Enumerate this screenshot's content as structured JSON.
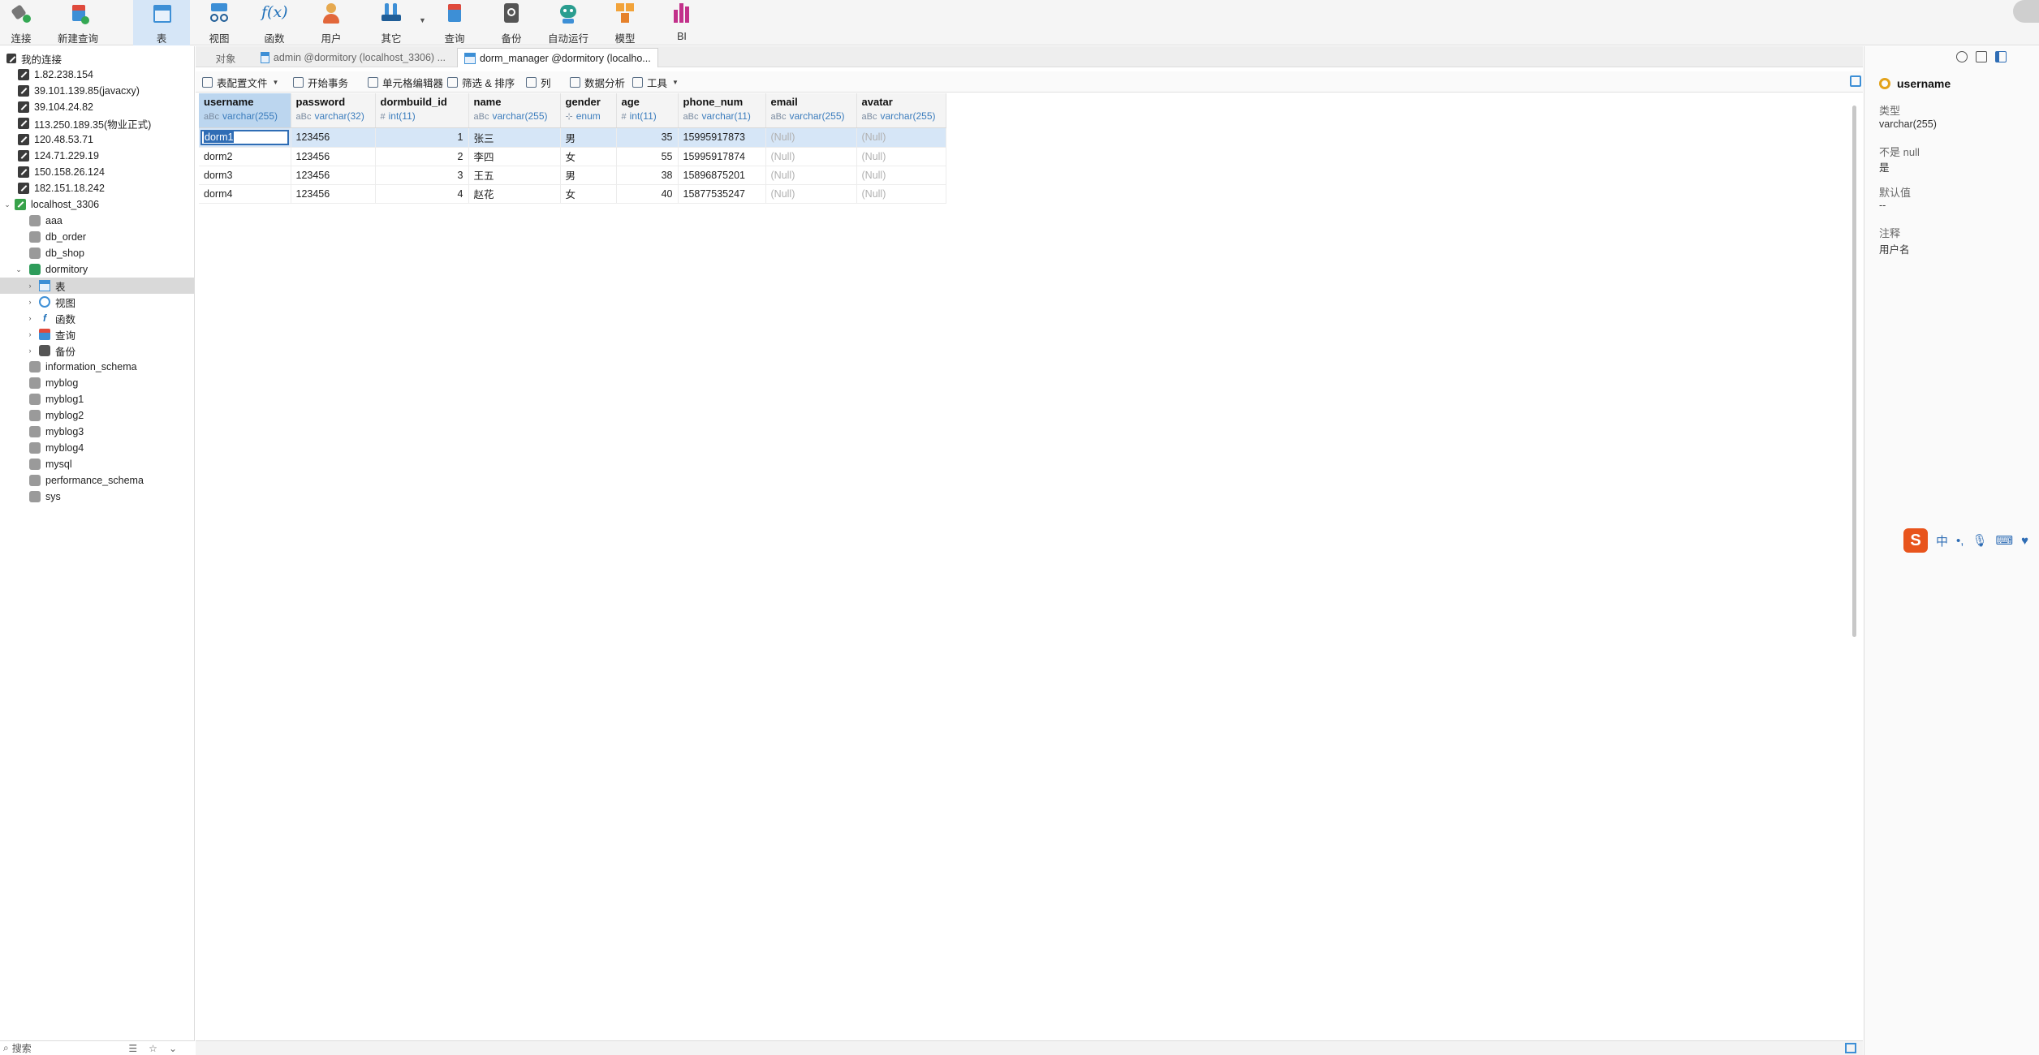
{
  "toolbar": {
    "connect": "连接",
    "new_query": "新建查询",
    "table": "表",
    "view": "视图",
    "function": "函数",
    "user": "用户",
    "other": "其它",
    "query": "查询",
    "backup": "备份",
    "automation": "自动运行",
    "model": "模型",
    "bi": "BI",
    "function_glyph": "f(x)"
  },
  "sidebar": {
    "header": "我的连接",
    "connections": [
      "1.82.238.154",
      "39.101.139.85(javacxy)",
      "39.104.24.82",
      "113.250.189.35(物业正式)",
      "120.48.53.71",
      "124.71.229.19",
      "150.158.26.124",
      "182.151.18.242"
    ],
    "localhost": "localhost_3306",
    "databases_before": [
      "aaa",
      "db_order",
      "db_shop"
    ],
    "open_db": "dormitory",
    "open_db_children": [
      "表",
      "视图",
      "函数",
      "查询",
      "备份"
    ],
    "databases_after": [
      "information_schema",
      "myblog",
      "myblog1",
      "myblog2",
      "myblog3",
      "myblog4",
      "mysql",
      "performance_schema",
      "sys"
    ],
    "search": "搜索"
  },
  "tabs": {
    "objects": "对象",
    "tab1": "admin @dormitory (localhost_3306) ...",
    "tab2": "dorm_manager @dormitory (localho..."
  },
  "subbar": {
    "config": "表配置文件",
    "begin_tx": "开始事务",
    "cell_editor": "单元格编辑器",
    "filter_sort": "筛选 & 排序",
    "columns": "列",
    "analysis": "数据分析",
    "tools": "工具"
  },
  "grid": {
    "columns": [
      {
        "name": "username",
        "type": "varchar(255)",
        "kind": "aBc"
      },
      {
        "name": "password",
        "type": "varchar(32)",
        "kind": "aBc"
      },
      {
        "name": "dormbuild_id",
        "type": "int(11)",
        "kind": "#"
      },
      {
        "name": "name",
        "type": "varchar(255)",
        "kind": "aBc"
      },
      {
        "name": "gender",
        "type": "enum",
        "kind": "⊹"
      },
      {
        "name": "age",
        "type": "int(11)",
        "kind": "#"
      },
      {
        "name": "phone_num",
        "type": "varchar(11)",
        "kind": "aBc"
      },
      {
        "name": "email",
        "type": "varchar(255)",
        "kind": "aBc"
      },
      {
        "name": "avatar",
        "type": "varchar(255)",
        "kind": "aBc"
      }
    ],
    "rows": [
      [
        "dorm1",
        "123456",
        "1",
        "张三",
        "男",
        "35",
        "15995917873",
        "(Null)",
        "(Null)"
      ],
      [
        "dorm2",
        "123456",
        "2",
        "李四",
        "女",
        "55",
        "15995917874",
        "(Null)",
        "(Null)"
      ],
      [
        "dorm3",
        "123456",
        "3",
        "王五",
        "男",
        "38",
        "15896875201",
        "(Null)",
        "(Null)"
      ],
      [
        "dorm4",
        "123456",
        "4",
        "赵花",
        "女",
        "40",
        "15877535247",
        "(Null)",
        "(Null)"
      ]
    ]
  },
  "rpanel": {
    "field": "username",
    "type_label": "类型",
    "type_value": "varchar(255)",
    "notnull_label": "不是 null",
    "notnull_value": "是",
    "default_label": "默认值",
    "default_value": "--",
    "comment_label": "注释",
    "comment_value": "用户名"
  },
  "ime": {
    "logo": "S",
    "lang": "中",
    "punct": "•,"
  },
  "colors": {
    "accent": "#2f6db5",
    "selection": "#d6e6f7",
    "null_text": "#b0b0b0"
  }
}
